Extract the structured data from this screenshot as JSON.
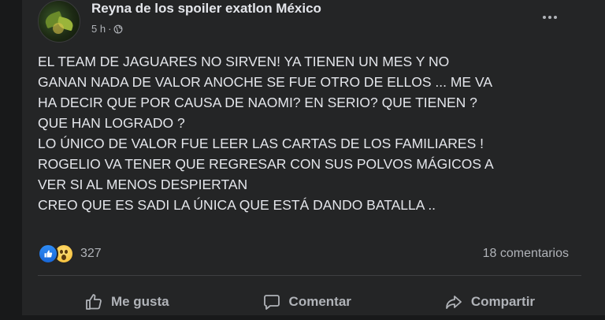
{
  "post": {
    "author": "Reyna de los spoiler exatlon México",
    "time": "5 h",
    "separator": "·",
    "privacy_icon": "globe-icon",
    "lines": [
      "EL TEAM DE JAGUARES  NO SIRVEN! YA TIENEN UN MES Y NO",
      "GANAN NADA DE VALOR  ANOCHE SE FUE OTRO DE ELLOS  ... ME VA",
      "HA DECIR QUE POR CAUSA DE NAOMI? EN SERIO? QUE TIENEN ?",
      "QUE HAN LOGRADO ?",
      "LO ÚNICO DE VALOR FUE LEER LAS CARTAS DE LOS FAMILIARES !",
      "ROGELIO VA TENER QUE REGRESAR CON SUS POLVOS MÁGICOS A",
      "VER SI AL MENOS DESPIERTAN",
      "CREO QUE ES SADI LA ÚNICA QUE ESTÁ DANDO BATALLA .."
    ],
    "reaction_count": "327",
    "comments_count": "18 comentarios"
  },
  "actions": {
    "like": "Me gusta",
    "comment": "Comentar",
    "share": "Compartir"
  },
  "colors": {
    "background": "#18191a",
    "card": "#242526",
    "text": "#e4e6eb",
    "secondary": "#b0b3b8",
    "like_blue": "#1877f2",
    "wow_yellow": "#f7b928"
  }
}
